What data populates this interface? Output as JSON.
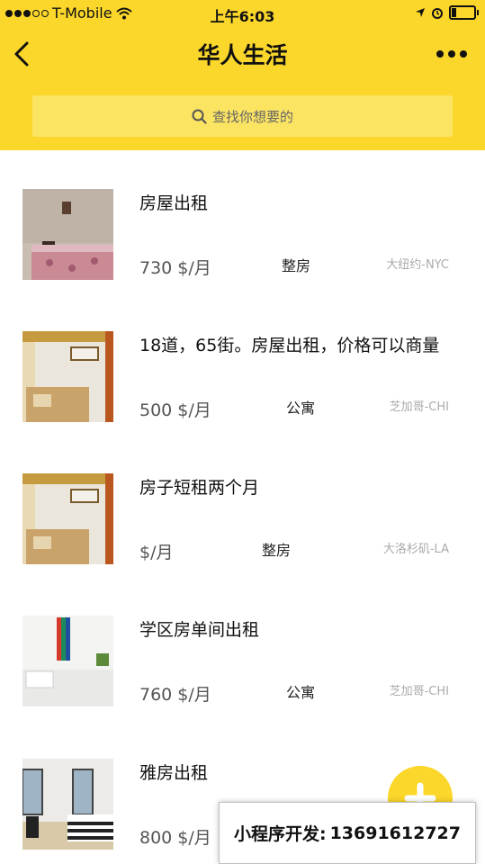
{
  "status_bar": {
    "carrier": "T-Mobile",
    "time": "上午6:03"
  },
  "nav": {
    "title": "华人生活"
  },
  "search": {
    "placeholder": "查找你想要的"
  },
  "listings": [
    {
      "title": "房屋出租",
      "price": "730 $/月",
      "type": "整房",
      "location": "大纽约-NYC"
    },
    {
      "title": "18道，65街。房屋出租，价格可以商量",
      "price": "500 $/月",
      "type": "公寓",
      "location": "芝加哥-CHI"
    },
    {
      "title": "房子短租两个月",
      "price": "$/月",
      "type": "整房",
      "location": "大洛杉矶-LA"
    },
    {
      "title": "学区房单间出租",
      "price": "760 $/月",
      "type": "公寓",
      "location": "芝加哥-CHI"
    },
    {
      "title": "雅房出租",
      "price": "800 $/月",
      "type": "",
      "location": ""
    }
  ],
  "promo": {
    "label": "小程序开发:",
    "phone": "13691612727"
  },
  "colors": {
    "brand_yellow": "#fbd72b",
    "search_bg": "#fce463"
  }
}
